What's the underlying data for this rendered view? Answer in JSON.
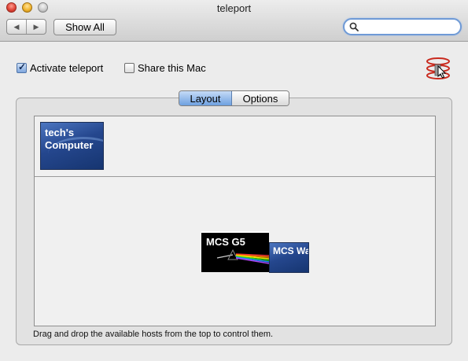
{
  "window": {
    "title": "teleport",
    "colors": {
      "close": "#e0463a",
      "minimize": "#f1b52f",
      "zoom": "#c9c9c9"
    }
  },
  "toolbar": {
    "back_icon": "triangle-left",
    "forward_icon": "triangle-right",
    "show_all_label": "Show All",
    "search": {
      "value": "",
      "placeholder": "",
      "icon": "magnifier"
    }
  },
  "options": {
    "activate": {
      "label": "Activate teleport",
      "checked": true
    },
    "share": {
      "label": "Share this Mac",
      "checked": false
    },
    "status_icon": "teleport-rings-icon"
  },
  "tabs": [
    {
      "label": "Layout",
      "selected": true
    },
    {
      "label": "Options",
      "selected": false
    }
  ],
  "layout": {
    "available_hosts": [
      {
        "name": "tech's Computer"
      }
    ],
    "arranged_hosts": [
      {
        "name": "MCS G5",
        "kind": "desktop-wallpaper"
      },
      {
        "name": "MCS Wallst",
        "kind": "blue-aqua"
      }
    ],
    "hint": "Drag and drop the available hosts from the top to control them."
  },
  "colors": {
    "accent": "#6ea0e0",
    "host_blue": "#25478e"
  }
}
